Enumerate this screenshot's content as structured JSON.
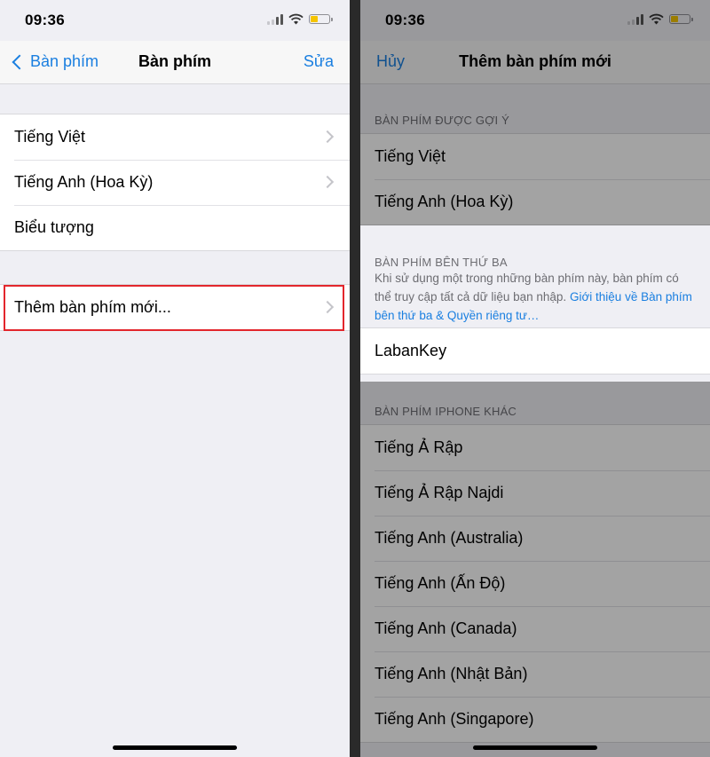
{
  "left": {
    "status": {
      "time": "09:36"
    },
    "nav": {
      "back": "Bàn phím",
      "title": "Bàn phím",
      "edit": "Sửa"
    },
    "keyboards": [
      {
        "label": "Tiếng Việt"
      },
      {
        "label": "Tiếng Anh (Hoa Kỳ)"
      },
      {
        "label": "Biểu tượng"
      }
    ],
    "add_keyboard": "Thêm bàn phím mới..."
  },
  "right": {
    "status": {
      "time": "09:36"
    },
    "nav": {
      "cancel": "Hủy",
      "title": "Thêm bàn phím mới"
    },
    "suggested_header": "BÀN PHÍM ĐƯỢC GỢI Ý",
    "suggested": [
      {
        "label": "Tiếng Việt"
      },
      {
        "label": "Tiếng Anh (Hoa Kỳ)"
      }
    ],
    "third_party_header": "BÀN PHÍM BÊN THỨ BA",
    "third_party_note": "Khi sử dụng một trong những bàn phím này, bàn phím có thể truy cập tất cả dữ liệu bạn nhập. ",
    "third_party_link": "Giới thiệu về Bàn phím bên thứ ba & Quyền riêng tư…",
    "third_party": [
      {
        "label": "LabanKey"
      }
    ],
    "other_header": "BÀN PHÍM IPHONE KHÁC",
    "other": [
      {
        "label": "Tiếng Ả Rập"
      },
      {
        "label": "Tiếng Ả Rập Najdi"
      },
      {
        "label": "Tiếng Anh (Australia)"
      },
      {
        "label": "Tiếng Anh (Ấn Độ)"
      },
      {
        "label": "Tiếng Anh (Canada)"
      },
      {
        "label": "Tiếng Anh (Nhật Bản)"
      },
      {
        "label": "Tiếng Anh (Singapore)"
      }
    ]
  },
  "colors": {
    "accent": "#1a7fe0",
    "highlight_border": "#e3262c",
    "battery": "#f5c400"
  }
}
